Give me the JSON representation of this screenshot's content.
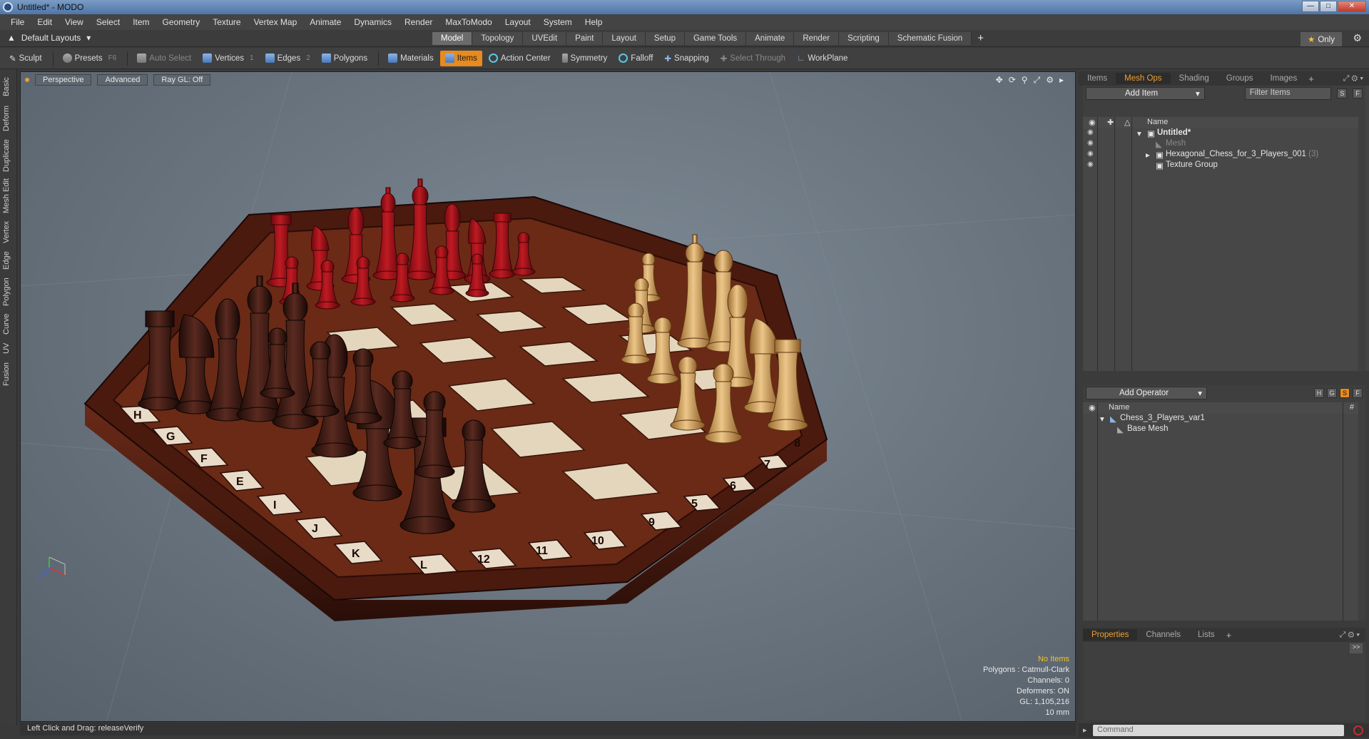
{
  "window": {
    "title": "Untitled* - MODO"
  },
  "menu": [
    "File",
    "Edit",
    "View",
    "Select",
    "Item",
    "Geometry",
    "Texture",
    "Vertex Map",
    "Animate",
    "Dynamics",
    "Render",
    "MaxToModo",
    "Layout",
    "System",
    "Help"
  ],
  "layout": {
    "selector": "Default Layouts",
    "tabs": [
      "Model",
      "Topology",
      "UVEdit",
      "Paint",
      "Layout",
      "Setup",
      "Game Tools",
      "Animate",
      "Render",
      "Scripting",
      "Schematic Fusion"
    ],
    "active_tab": "Model",
    "only_label": "Only"
  },
  "toolbar": {
    "sculpt": "Sculpt",
    "presets": "Presets",
    "presets_key": "F6",
    "auto_select": "Auto Select",
    "vertices": "Vertices",
    "vertices_key": "1",
    "edges": "Edges",
    "edges_key": "2",
    "polygons": "Polygons",
    "materials": "Materials",
    "items": "Items",
    "action_center": "Action Center",
    "symmetry": "Symmetry",
    "falloff": "Falloff",
    "snapping": "Snapping",
    "select_through": "Select Through",
    "workplane": "WorkPlane"
  },
  "left_tabs": [
    "Basic",
    "Deform",
    "Duplicate",
    "Mesh Edit",
    "Vertex",
    "Edge",
    "Polygon",
    "Curve",
    "UV",
    "Fusion"
  ],
  "viewport": {
    "view": "Perspective",
    "shading": "Advanced",
    "raygl": "Ray GL: Off",
    "info": {
      "selection": "No Items",
      "polygons": "Polygons : Catmull-Clark",
      "channels": "Channels: 0",
      "deformers": "Deformers: ON",
      "gl": "GL: 1,105,216",
      "grid": "10 mm"
    },
    "board_letters": [
      "H",
      "G",
      "F",
      "E",
      "I",
      "J",
      "K",
      "L"
    ],
    "board_numbers": [
      "5",
      "6",
      "7",
      "8"
    ],
    "board_labels_front": [
      "12",
      "11",
      "10",
      "9"
    ]
  },
  "status": {
    "text": "Left Click and Drag:  releaseVerify"
  },
  "items_panel": {
    "tabs": [
      "Items",
      "Mesh Ops",
      "Shading",
      "Groups",
      "Images"
    ],
    "active_tab": "Mesh Ops",
    "add_item": "Add Item",
    "filter_placeholder": "Filter Items",
    "s_btn": "S",
    "f_btn": "F",
    "column_name": "Name",
    "tree": [
      {
        "label": "Untitled*",
        "count": ""
      },
      {
        "label": "Mesh",
        "count": ""
      },
      {
        "label": "Hexagonal_Chess_for_3_Players_001",
        "count": "(3)"
      },
      {
        "label": "Texture Group",
        "count": ""
      }
    ]
  },
  "operator_panel": {
    "add_operator": "Add Operator",
    "h_btn": "H",
    "g_btn": "G",
    "s_btn": "S",
    "f_btn": "F",
    "column_name": "Name",
    "column_hash": "#",
    "tree": [
      {
        "label": "Chess_3_Players_var1"
      },
      {
        "label": "Base Mesh"
      }
    ]
  },
  "properties_panel": {
    "tabs": [
      "Properties",
      "Channels",
      "Lists"
    ],
    "active_tab": "Properties"
  },
  "command": {
    "placeholder": "Command"
  },
  "colors": {
    "accent": "#e88a1e",
    "board_dark": "#5a2414",
    "board_light": "#e8dcc8",
    "piece_red": "#a01018",
    "piece_dark": "#3a1a14",
    "piece_light": "#d8a860"
  }
}
